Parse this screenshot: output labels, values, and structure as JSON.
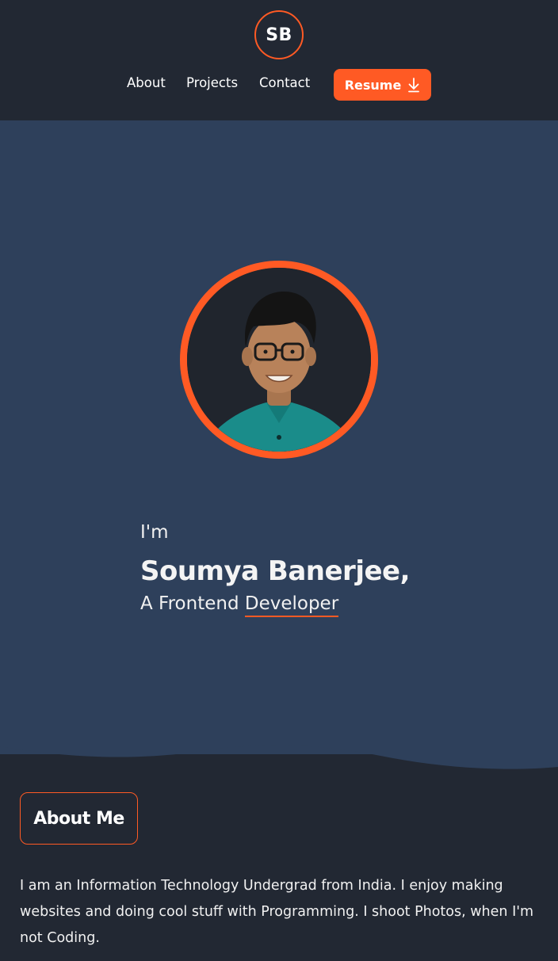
{
  "header": {
    "logo_text": "SB",
    "nav": {
      "about": "About",
      "projects": "Projects",
      "contact": "Contact"
    },
    "resume_label": "Resume",
    "resume_icon": "download-arrow-icon"
  },
  "hero": {
    "greeting": "I'm",
    "name": "Soumya Banerjee,",
    "role_prefix": "A Frontend",
    "role_highlight": "Developer"
  },
  "about": {
    "title": "About Me",
    "text": "I am an Information Technology Undergrad from India. I enjoy making websites and doing cool stuff with Programming. I shoot Photos, when I'm not Coding."
  },
  "colors": {
    "accent": "#ff5a24",
    "background": "#222833",
    "hero_background": "#2e405b",
    "text": "#f1f1f1"
  }
}
